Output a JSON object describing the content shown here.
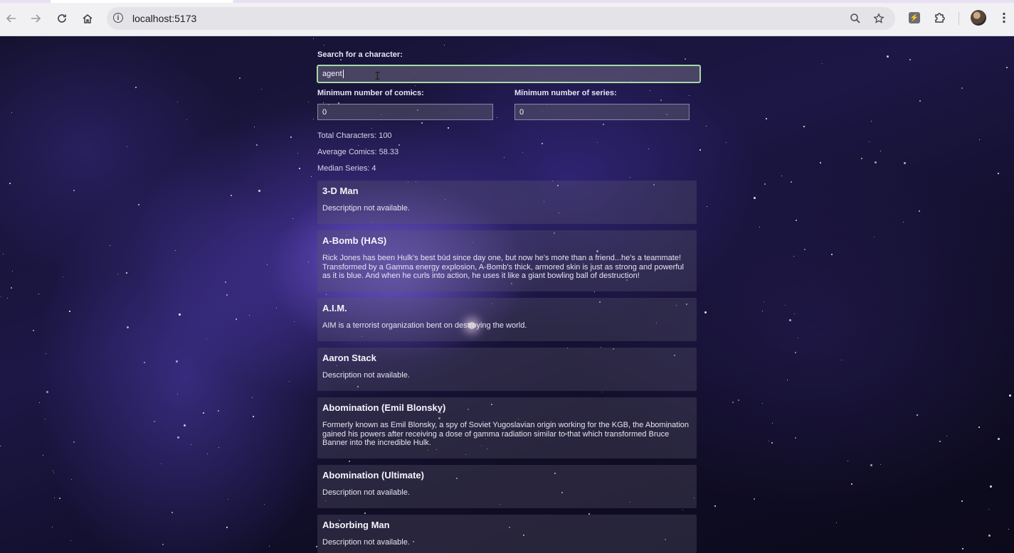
{
  "browser": {
    "url": "localhost:5173",
    "icons": {
      "back": "arrow-left-icon",
      "forward": "arrow-right-icon",
      "reload": "reload-icon",
      "home": "home-icon",
      "site_info": "info-icon",
      "zoom": "zoom-icon",
      "bookmark": "star-icon",
      "extension": "extension-icon",
      "extensions_menu": "puzzle-icon",
      "profile": "avatar",
      "menu": "kebab-menu-icon"
    }
  },
  "search": {
    "label": "Search for a character:",
    "value": "agent"
  },
  "filters": {
    "min_comics_label": "Minimum number of comics:",
    "min_comics_value": "0",
    "min_series_label": "Minimum number of series:",
    "min_series_value": "0"
  },
  "stats": {
    "total": "Total Characters: 100",
    "average_comics": "Average Comics: 58.33",
    "median_series": "Median Series: 4"
  },
  "characters": [
    {
      "name": "3-D Man",
      "description": "Description not available."
    },
    {
      "name": "A-Bomb (HAS)",
      "description": "Rick Jones has been Hulk's best bud since day one, but now he's more than a friend...he's a teammate! Transformed by a Gamma energy explosion, A-Bomb's thick, armored skin is just as strong and powerful as it is blue. And when he curls into action, he uses it like a giant bowling ball of destruction!"
    },
    {
      "name": "A.I.M.",
      "description": "AIM is a terrorist organization bent on destroying the world."
    },
    {
      "name": "Aaron Stack",
      "description": "Description not available."
    },
    {
      "name": "Abomination (Emil Blonsky)",
      "description": "Formerly known as Emil Blonsky, a spy of Soviet Yugoslavian origin working for the KGB, the Abomination gained his powers after receiving a dose of gamma radiation similar to that which transformed Bruce Banner into the incredible Hulk."
    },
    {
      "name": "Abomination (Ultimate)",
      "description": "Description not available."
    },
    {
      "name": "Absorbing Man",
      "description": "Description not available."
    }
  ],
  "colors": {
    "focus_ring": "#a6d9a6",
    "background": "#1c1745"
  }
}
